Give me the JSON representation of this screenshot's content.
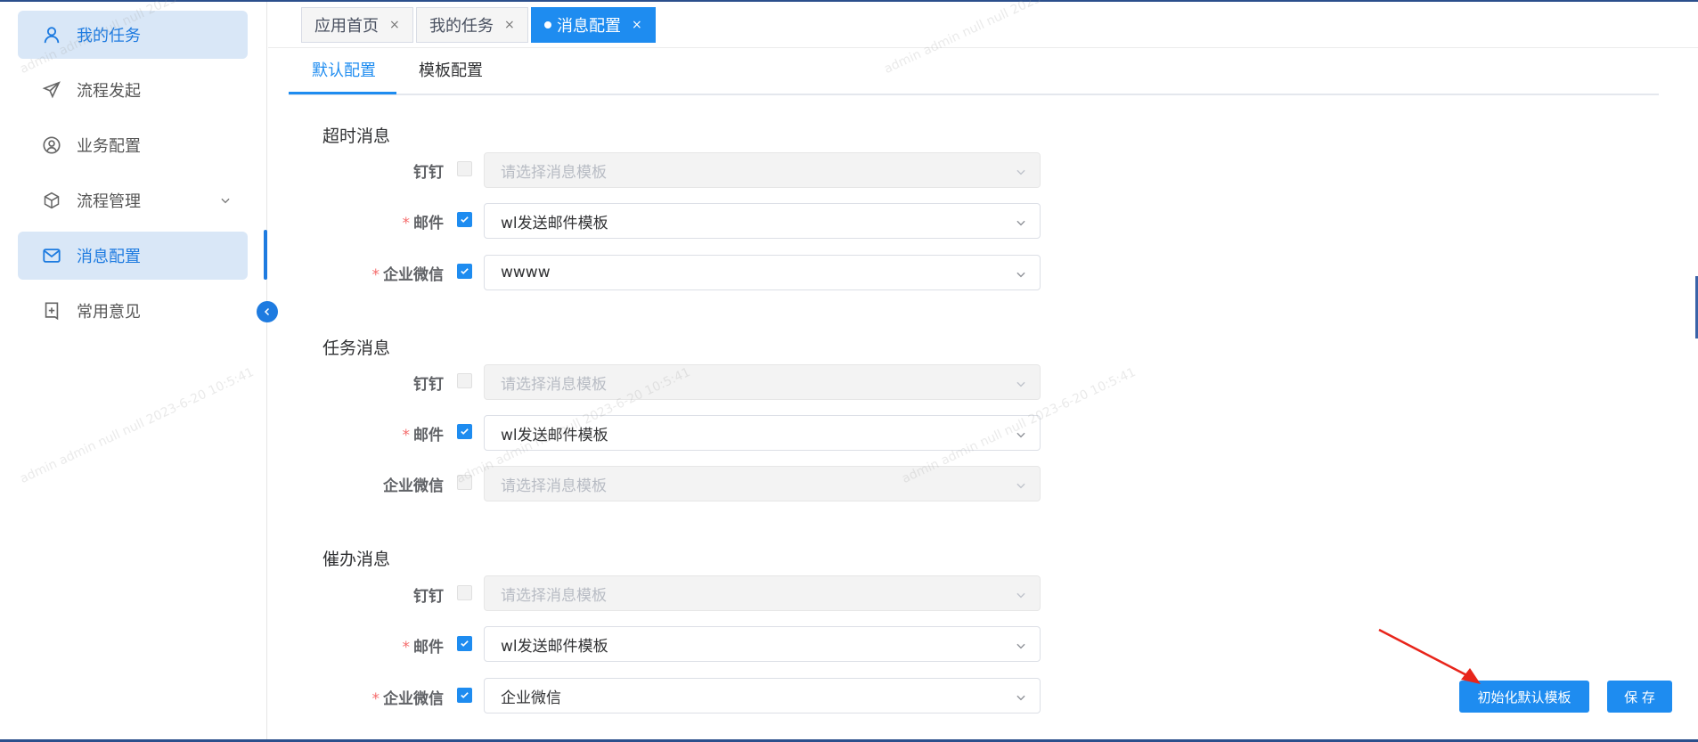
{
  "sidebar": {
    "items": [
      {
        "label": "我的任务",
        "icon": "user-icon",
        "active": true
      },
      {
        "label": "流程发起",
        "icon": "send-icon",
        "active": false
      },
      {
        "label": "业务配置",
        "icon": "user-circle-icon",
        "active": false
      },
      {
        "label": "流程管理",
        "icon": "cube-icon",
        "active": false,
        "expandable": true
      },
      {
        "label": "消息配置",
        "icon": "mail-icon",
        "active": true
      },
      {
        "label": "常用意见",
        "icon": "note-add-icon",
        "active": false
      }
    ],
    "collapse_icon": "chevron-left-icon"
  },
  "tabs": [
    {
      "label": "应用首页",
      "close": "×",
      "active": false
    },
    {
      "label": "我的任务",
      "close": "×",
      "active": false
    },
    {
      "label": "消息配置",
      "close": "×",
      "active": true
    }
  ],
  "subtabs": [
    {
      "label": "默认配置",
      "active": true
    },
    {
      "label": "模板配置",
      "active": false
    }
  ],
  "sections": [
    {
      "title": "超时消息",
      "rows": [
        {
          "label": "钉钉",
          "required": false,
          "checked": false,
          "disabled": true,
          "value": "",
          "placeholder": "请选择消息模板"
        },
        {
          "label": "邮件",
          "required": true,
          "checked": true,
          "disabled": false,
          "value": "wl发送邮件模板",
          "placeholder": ""
        },
        {
          "label": "企业微信",
          "required": true,
          "checked": true,
          "disabled": false,
          "value": "wwww",
          "placeholder": ""
        }
      ]
    },
    {
      "title": "任务消息",
      "rows": [
        {
          "label": "钉钉",
          "required": false,
          "checked": false,
          "disabled": true,
          "value": "",
          "placeholder": "请选择消息模板"
        },
        {
          "label": "邮件",
          "required": true,
          "checked": true,
          "disabled": false,
          "value": "wl发送邮件模板",
          "placeholder": ""
        },
        {
          "label": "企业微信",
          "required": false,
          "checked": false,
          "disabled": true,
          "value": "",
          "placeholder": "请选择消息模板"
        }
      ]
    },
    {
      "title": "催办消息",
      "rows": [
        {
          "label": "钉钉",
          "required": false,
          "checked": false,
          "disabled": true,
          "value": "",
          "placeholder": "请选择消息模板"
        },
        {
          "label": "邮件",
          "required": true,
          "checked": true,
          "disabled": false,
          "value": "wl发送邮件模板",
          "placeholder": ""
        },
        {
          "label": "企业微信",
          "required": true,
          "checked": true,
          "disabled": false,
          "value": "企业微信",
          "placeholder": ""
        }
      ]
    }
  ],
  "required_mark": "*",
  "buttons": {
    "init_default": "初始化默认模板",
    "save": "保 存"
  },
  "watermark": "admin admin null null 2023-6-20 10:5:41",
  "colors": {
    "primary": "#1e8cf0",
    "active_menu_bg": "#d9e7f7",
    "required": "#f56c6c",
    "annotation_arrow": "#e8251b"
  }
}
